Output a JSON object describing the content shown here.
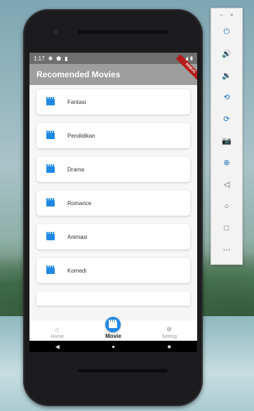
{
  "status_bar": {
    "time": "1:17",
    "icons_left": [
      "gear-icon",
      "shield-icon",
      "sim-icon"
    ],
    "icons_right": [
      "wifi-icon",
      "signal-icon",
      "battery-icon"
    ]
  },
  "app_bar": {
    "title": "Recomended Movies",
    "debug_banner": "DEBUG"
  },
  "categories": [
    {
      "label": "Fantasi",
      "icon": "movie-icon"
    },
    {
      "label": "Pendidikan",
      "icon": "movie-icon"
    },
    {
      "label": "Drama",
      "icon": "movie-icon"
    },
    {
      "label": "Romance",
      "icon": "movie-icon"
    },
    {
      "label": "Animasi",
      "icon": "movie-icon"
    },
    {
      "label": "Komedi",
      "icon": "movie-icon"
    }
  ],
  "bottom_nav": {
    "items": [
      {
        "label": "Home",
        "icon": "home-icon",
        "active": false
      },
      {
        "label": "Movie",
        "icon": "movie-icon",
        "active": true
      },
      {
        "label": "Setting",
        "icon": "gear-icon",
        "active": false
      }
    ]
  },
  "system_nav": {
    "back": "◀",
    "home": "●",
    "recents": "■"
  },
  "emulator_toolbar": {
    "window_controls": {
      "minimize": "–",
      "close": "×"
    },
    "buttons": [
      {
        "name": "power-icon",
        "glyph": "⏻"
      },
      {
        "name": "volume-up-icon",
        "glyph": "🔊"
      },
      {
        "name": "volume-down-icon",
        "glyph": "🔉"
      },
      {
        "name": "rotate-left-icon",
        "glyph": "⟲"
      },
      {
        "name": "rotate-right-icon",
        "glyph": "⟳"
      },
      {
        "name": "camera-icon",
        "glyph": "📷"
      },
      {
        "name": "zoom-icon",
        "glyph": "⊕"
      },
      {
        "name": "back-icon",
        "glyph": "◁"
      },
      {
        "name": "home-icon",
        "glyph": "○"
      },
      {
        "name": "overview-icon",
        "glyph": "□"
      },
      {
        "name": "more-icon",
        "glyph": "⋯"
      }
    ]
  },
  "colors": {
    "accent": "#1e88e5",
    "app_bar": "#9e9e9e",
    "status_bar": "#6e6e6e"
  }
}
